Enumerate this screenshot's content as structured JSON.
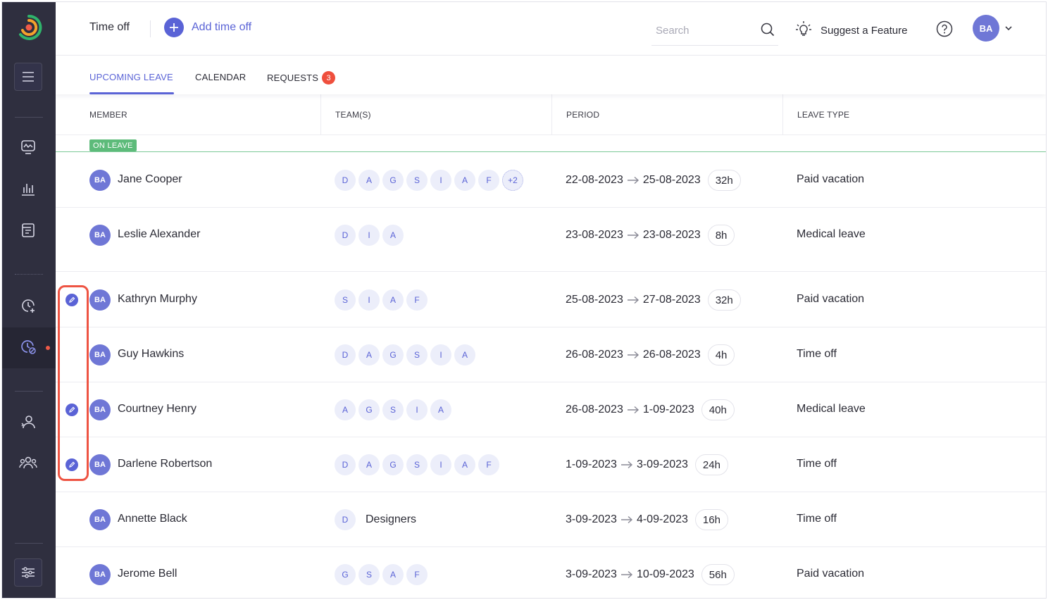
{
  "sidebar": {
    "icons": [
      "logo-icon",
      "menu-icon",
      "dashboard-icon",
      "reports-icon",
      "timesheets-icon",
      "time-tracking-icon",
      "time-off-icon",
      "member-icon",
      "teams-icon",
      "settings-icon"
    ],
    "accent": "#ef5a48"
  },
  "header": {
    "title": "Time off",
    "add_label": "Add time off",
    "search_placeholder": "Search",
    "suggest_label": "Suggest a Feature",
    "user_initials": "BA"
  },
  "tabs": [
    {
      "label": "UPCOMING LEAVE",
      "active": true
    },
    {
      "label": "CALENDAR",
      "active": false
    },
    {
      "label": "REQUESTS",
      "active": false,
      "badge": "3"
    }
  ],
  "columns": {
    "member": "MEMBER",
    "teams": "TEAM(S)",
    "period": "PERIOD",
    "leave_type": "LEAVE TYPE"
  },
  "on_leave_label": "ON LEAVE",
  "colors": {
    "accent": "#5a63d6",
    "on_leave": "#5dbb7a",
    "badge": "#ef4f3d",
    "highlight": "#ee5443"
  },
  "on_leave_rows": [
    {
      "initials": "BA",
      "name": "Jane Cooper",
      "teams": [
        "D",
        "A",
        "G",
        "S",
        "I",
        "A",
        "F"
      ],
      "more": "+2",
      "team_name": "",
      "start": "22-08-2023",
      "end": "25-08-2023",
      "hours": "32h",
      "leave_type": "Paid vacation",
      "editable": false
    },
    {
      "initials": "BA",
      "name": "Leslie Alexander",
      "teams": [
        "D",
        "I",
        "A"
      ],
      "more": "",
      "team_name": "",
      "start": "23-08-2023",
      "end": "23-08-2023",
      "hours": "8h",
      "leave_type": "Medical leave",
      "editable": false
    }
  ],
  "upcoming_rows": [
    {
      "initials": "BA",
      "name": "Kathryn Murphy",
      "teams": [
        "S",
        "I",
        "A",
        "F"
      ],
      "more": "",
      "team_name": "",
      "start": "25-08-2023",
      "end": "27-08-2023",
      "hours": "32h",
      "leave_type": "Paid vacation",
      "editable": true
    },
    {
      "initials": "BA",
      "name": "Guy Hawkins",
      "teams": [
        "D",
        "A",
        "G",
        "S",
        "I",
        "A"
      ],
      "more": "",
      "team_name": "",
      "start": "26-08-2023",
      "end": "26-08-2023",
      "hours": "4h",
      "leave_type": "Time off",
      "editable": false
    },
    {
      "initials": "BA",
      "name": "Courtney Henry",
      "teams": [
        "A",
        "G",
        "S",
        "I",
        "A"
      ],
      "more": "",
      "team_name": "",
      "start": "26-08-2023",
      "end": "1-09-2023",
      "hours": "40h",
      "leave_type": "Medical leave",
      "editable": true
    },
    {
      "initials": "BA",
      "name": "Darlene Robertson",
      "teams": [
        "D",
        "A",
        "G",
        "S",
        "I",
        "A",
        "F"
      ],
      "more": "",
      "team_name": "",
      "start": "1-09-2023",
      "end": "3-09-2023",
      "hours": "24h",
      "leave_type": "Time off",
      "editable": true
    },
    {
      "initials": "BA",
      "name": "Annette Black",
      "teams": [
        "D"
      ],
      "more": "",
      "team_name": "Designers",
      "start": "3-09-2023",
      "end": "4-09-2023",
      "hours": "16h",
      "leave_type": "Time off",
      "editable": false
    },
    {
      "initials": "BA",
      "name": "Jerome Bell",
      "teams": [
        "G",
        "S",
        "A",
        "F"
      ],
      "more": "",
      "team_name": "",
      "start": "3-09-2023",
      "end": "10-09-2023",
      "hours": "56h",
      "leave_type": "Paid vacation",
      "editable": false
    }
  ]
}
